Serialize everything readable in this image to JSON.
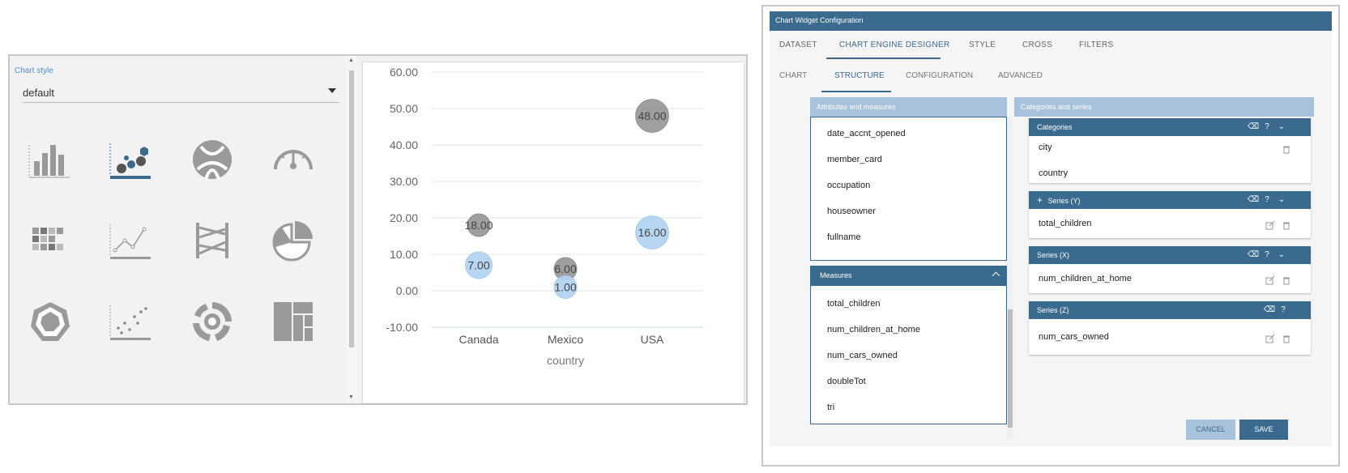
{
  "left": {
    "style_label": "Chart style",
    "style_value": "default",
    "chart_types": [
      {
        "icon": "bar-chart-icon"
      },
      {
        "icon": "bubble-chart-icon",
        "selected": true
      },
      {
        "icon": "chord-chart-icon"
      },
      {
        "icon": "gauge-chart-icon"
      },
      {
        "icon": "heatmap-chart-icon"
      },
      {
        "icon": "line-chart-icon"
      },
      {
        "icon": "parallel-chart-icon"
      },
      {
        "icon": "pie-chart-icon"
      },
      {
        "icon": "radar-chart-icon"
      },
      {
        "icon": "scatter-chart-icon"
      },
      {
        "icon": "sunburst-chart-icon"
      },
      {
        "icon": "treemap-chart-icon"
      }
    ]
  },
  "chart_data": {
    "type": "scatter",
    "xlabel": "country",
    "ylabel": "",
    "categories": [
      "Canada",
      "Mexico",
      "USA"
    ],
    "ylim": [
      -10,
      60
    ],
    "yticks": [
      "60.00",
      "50.00",
      "40.00",
      "30.00",
      "20.00",
      "10.00",
      "0.00",
      "-10.00"
    ],
    "grid": true,
    "series": [
      {
        "color": "#9a9a9a",
        "points": [
          {
            "category": "Canada",
            "y": 18,
            "label": "18.00"
          },
          {
            "category": "Mexico",
            "y": 6,
            "label": "6.00"
          },
          {
            "category": "USA",
            "y": 48,
            "label": "48.00"
          }
        ]
      },
      {
        "color": "#b3d4f2",
        "points": [
          {
            "category": "Canada",
            "y": 7,
            "label": "7.00"
          },
          {
            "category": "Mexico",
            "y": 1,
            "label": "1.00"
          },
          {
            "category": "USA",
            "y": 16,
            "label": "16.00"
          }
        ]
      }
    ]
  },
  "dialog": {
    "title": "Chart Widget Configuration",
    "main_tabs": [
      "DATASET",
      "CHART ENGINE DESIGNER",
      "STYLE",
      "CROSS",
      "FILTERS"
    ],
    "sub_tabs": [
      "CHART",
      "STRUCTURE",
      "CONFIGURATION",
      "ADVANCED"
    ],
    "attributes_header": "Attributes and measures",
    "attributes": [
      "date_accnt_opened",
      "member_card",
      "occupation",
      "houseowner",
      "fullname"
    ],
    "measures_header": "Measures",
    "measures": [
      "total_children",
      "num_children_at_home",
      "num_cars_owned",
      "doubleTot",
      "tri"
    ],
    "categories_series_header": "Categories and series",
    "categories_section": {
      "title": "Categories",
      "items": [
        "city",
        "country"
      ]
    },
    "series_y_section": {
      "title": "Series (Y)",
      "add_symbol": "+",
      "items": [
        "total_children"
      ]
    },
    "series_x_section": {
      "title": "Series (X)",
      "items": [
        "num_children_at_home"
      ]
    },
    "series_z_section": {
      "title": "Series (Z)",
      "items": [
        "num_cars_owned"
      ]
    },
    "cancel_label": "CANCEL",
    "save_label": "SAVE",
    "accent": "#3b6a8f"
  }
}
